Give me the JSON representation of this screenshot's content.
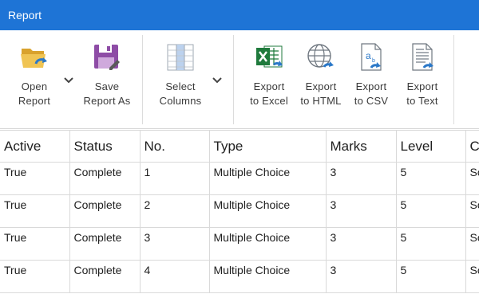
{
  "window": {
    "title": "Report"
  },
  "toolbar": {
    "open_report": "Open\nReport",
    "save_report_as": "Save\nReport As",
    "select_columns": "Select\nColumns",
    "export_excel": "Export\nto Excel",
    "export_html": "Export\nto HTML",
    "export_csv": "Export\nto CSV",
    "export_text": "Export\nto Text"
  },
  "table": {
    "headers": [
      "Active",
      "Status",
      "No.",
      "Type",
      "Marks",
      "Level",
      "C"
    ],
    "rows": [
      [
        "True",
        "Complete",
        "1",
        "Multiple Choice",
        "3",
        "5",
        "Sc"
      ],
      [
        "True",
        "Complete",
        "2",
        "Multiple Choice",
        "3",
        "5",
        "Sc"
      ],
      [
        "True",
        "Complete",
        "3",
        "Multiple Choice",
        "3",
        "5",
        "Sc"
      ],
      [
        "True",
        "Complete",
        "4",
        "Multiple Choice",
        "3",
        "5",
        "Sc"
      ]
    ]
  },
  "colors": {
    "titlebar": "#1e74d6",
    "excel_green": "#1f7a3c",
    "save_purple": "#8e4ca6",
    "folder_yellow": "#e8b33c",
    "arrow_blue": "#2b78c8"
  },
  "icons": {
    "open_report": "folder-open-icon",
    "save_report_as": "floppy-disk-icon",
    "select_columns": "columns-icon",
    "export_excel": "excel-icon",
    "export_html": "globe-icon",
    "export_csv": "csv-file-icon",
    "export_text": "text-file-icon"
  }
}
